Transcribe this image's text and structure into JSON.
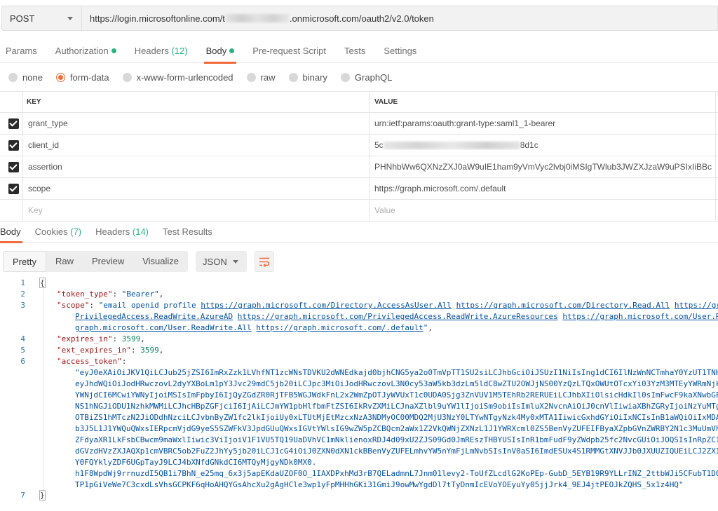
{
  "request": {
    "method": "POST",
    "url_prefix": "https://login.microsoftonline.com/t",
    "url_suffix": ".onmicrosoft.com/oauth2/v2.0/token"
  },
  "request_tabs": [
    {
      "label": "Params",
      "count": "",
      "dot": false,
      "active": false
    },
    {
      "label": "Authorization",
      "count": "",
      "dot": true,
      "active": false
    },
    {
      "label": "Headers",
      "count": "(12)",
      "dot": false,
      "active": false
    },
    {
      "label": "Body",
      "count": "",
      "dot": true,
      "active": true
    },
    {
      "label": "Pre-request Script",
      "count": "",
      "dot": false,
      "active": false
    },
    {
      "label": "Tests",
      "count": "",
      "dot": false,
      "active": false
    },
    {
      "label": "Settings",
      "count": "",
      "dot": false,
      "active": false
    }
  ],
  "body_types": [
    {
      "label": "none",
      "selected": false
    },
    {
      "label": "form-data",
      "selected": true
    },
    {
      "label": "x-www-form-urlencoded",
      "selected": false
    },
    {
      "label": "raw",
      "selected": false
    },
    {
      "label": "binary",
      "selected": false
    },
    {
      "label": "GraphQL",
      "selected": false
    }
  ],
  "params": {
    "key_header": "KEY",
    "value_header": "VALUE",
    "rows": [
      {
        "key": "grant_type",
        "value": "urn:ietf:params:oauth:grant-type:saml1_1-bearer"
      },
      {
        "key": "client_id",
        "value_prefix": "5c",
        "value_suffix": "8d1c"
      },
      {
        "key": "assertion",
        "value": "PHNhbWw6QXNzZXJ0aW9uIE1ham9yVmVyc2lvbj0iMSIgTWlub3JWZXJzaW9uPSIxIiBBc..."
      },
      {
        "key": "scope",
        "value": "https://graph.microsoft.com/.default"
      }
    ],
    "key_placeholder": "Key",
    "value_placeholder": "Value"
  },
  "response_tabs": [
    {
      "label": "Body",
      "count": ""
    },
    {
      "label": "Cookies",
      "count": "(7)"
    },
    {
      "label": "Headers",
      "count": "(14)"
    },
    {
      "label": "Test Results",
      "count": ""
    }
  ],
  "view_modes": [
    "Pretty",
    "Raw",
    "Preview",
    "Visualize"
  ],
  "format": "JSON",
  "code": {
    "line_numbers": [
      "1",
      "2",
      "3",
      "4",
      "5",
      "6",
      "7"
    ],
    "open_brace": "{",
    "close_brace": "}",
    "token_type_key": "\"token_type\"",
    "token_type_val": "\"Bearer\"",
    "scope_key": "\"scope\"",
    "scope_val_1": "\"email openid profile ",
    "scope_url_1": "https://graph.microsoft.com/Directory.AccessAsUser.All",
    "scope_url_2": "https://graph.microsoft.com/Directory.Read.All",
    "scope_url_3": "https://gra",
    "scope_line2_a": "PrivilegedAccess.ReadWrite.AzureAD",
    "scope_url_4": "https://graph.microsoft.com/PrivilegedAccess.ReadWrite.AzureResources",
    "scope_url_5": "https://graph.microsoft.com/User.Re",
    "scope_line3_a": "graph.microsoft.com/User.ReadWrite.All",
    "scope_url_6": "https://graph.microsoft.com/.default",
    "expires_in_key": "\"expires_in\"",
    "expires_in_val": "3599",
    "ext_expires_in_key": "\"ext_expires_in\"",
    "ext_expires_in_val": "3599",
    "access_token_key": "\"access_token\"",
    "access_token_lines": [
      "\"eyJ0eXAiOiJKV1QiLCJub25jZSI6ImRxZzk1LVhfNT1zcWNsTDVKU2dWNEdkajd0bjhCNG5ya2o0TmVpTT1SU2siLCJhbGciOiJSUzI1NiIsIng1dCI6IlNzWnNCTmhaY0YzUT1TNHR",
      "eyJhdWQiOiJodHRwczovL2dyYXBoLm1pY3Jvc29mdC5jb20iLCJpc3MiOiJodHRwczovL3N0cy53aW5kb3dzLm5ldC8wZTU2OWJjNS00YzQzLTQxOWUtOTcxYi03YzM3MTEyYWRmNjkv",
      "YWNjdCI6MCwiYWNyIjoiMSIsImFpbyI6IjQyZGdZR0RjTFB5WGJWdkFnL2x2WmZpOTJyWVUxT1c0UDA0Sjg3ZnVUV1M5TEhRb2RERUEiLCJhbXIiOlsicHdkIl0sImFwcF9kaXNwbGF5",
      "NS1hNGJiODU1NzhkMWMiLCJhcHBpZGFjciI6IjAiLCJmYW1pbHlfbmFtZSI6IkRvZXMiLCJnaXZlbl9uYW1lIjoiSm9obiIsImluX2NvcnAiOiJ0cnVlIiwiaXBhZGRyIjoiNzYuMTgz",
      "OTBiZS1hMTczN2JiODdhNzciLCJvbnByZW1fc2lkIjoiUy0xLTUtMjEtMzcxNzA3NDMyOC00MDQ2MjU3NzY0LTYwNTgyNzk4My0xMTA1IiwicGxhdGYiOiIxNCIsInB1aWQiOiIxMDAz",
      "b3J5L1J1YWQuQWxsIERpcmVjdG9yeS5SZWFkV3JpdGUuQWxsIGVtYWlsIG9wZW5pZCBQcm2aWx1Z2VkQWNjZXNzL1J1YWRXcml0ZS5BenVyZUFEIFByaXZpbGVnZWRBY2N1c3MuUmVh",
      "ZFdyaXR1LkFsbCBwcm9maWxlIiwic3ViIjoiV1F1VU5TQ19UaDVhVC1mNklienoxRDJ4d09xU2ZJS09Gd0JmREszTHBYUSIsInR1bmFudF9yZWdpb25fc2NvcGUiOiJOQSIsInRpZCI6",
      "dGVzdHVzZXJAQXp1cmVBRC5ob2FuZ2JhYy5jb20iLCJ1cG4iOiJ0ZXN0dXN1ckBBenVyZUFELmhvYW5nYmFjLmNvbSIsInV0aSI6ImdESUx4S1RMMGtXNVJJb0JXUUZIQUEiLCJ2ZXIi",
      "Y0FQYklyZDF6UGpTayJ9LCJ4bXNfdGNkdCI6MTQyMjgyNDk0MX0.",
      "h1F8WpdWj9rrnuzdI5QB1i7BhN_e25mq_6x3j5apEKdaUZOF0O_1IAXDPxhMd3rB7QELadmnL7Jnm01levy2-ToUfZLcdlG2KoPEp-GubD_5EYB19R9YLLrINZ_2ttbWJi5CFubT1D0H",
      "TP1pGiVeWe7C3cxdLsVhsGCPKF6qHoAHQYGsAhcXu2gAgHCle3wp1yFpMHHhGKi31GmiJ9owMwYgdDl7tTyDnmIcEVoYOEyuYy05jjJrk4_9EJ4jtPEOJkZQHS_5x1z4HQ\""
    ]
  },
  "colors": {
    "accent": "#f26b3a",
    "success": "#26b47f",
    "json_key": "#a31515",
    "json_string": "#0451a5",
    "json_number": "#098658",
    "line_number": "#2a7b9b"
  }
}
